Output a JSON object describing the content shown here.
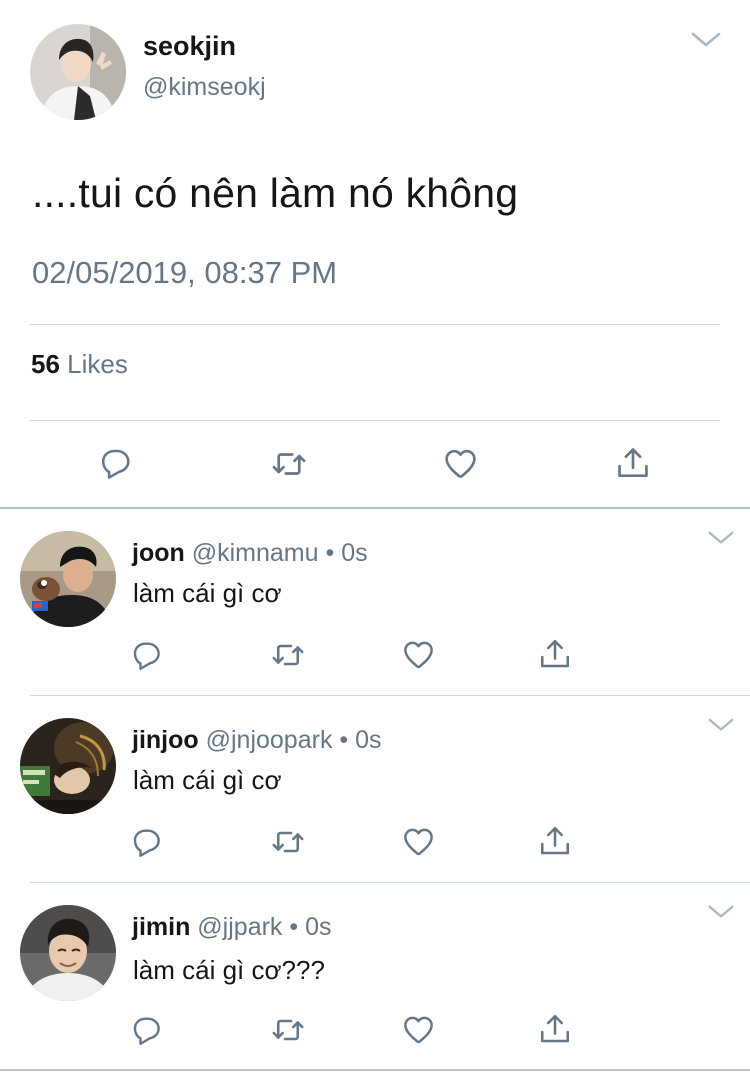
{
  "main_tweet": {
    "name": "seokjin",
    "handle": "@kimseokj",
    "text": "....tui có nên làm nó không",
    "timestamp": "02/05/2019, 08:37 PM",
    "likes_count": "56",
    "likes_label": "Likes",
    "icons": [
      "reply-icon",
      "retweet-icon",
      "like-icon",
      "share-icon",
      "chevron-down-icon"
    ]
  },
  "replies": [
    {
      "name": "joon",
      "handle": "@kimnamu",
      "dot": "•",
      "time": "0s",
      "text": "làm cái gì cơ"
    },
    {
      "name": "jinjoo",
      "handle": "@jnjoopark",
      "dot": "•",
      "time": "0s",
      "text": "làm cái gì cơ"
    },
    {
      "name": "jimin",
      "handle": "@jjpark",
      "dot": "•",
      "time": "0s",
      "text": "làm cái gì cơ???"
    }
  ],
  "colors": {
    "text_primary": "#14171a",
    "text_secondary": "#657786",
    "divider": "#ccd6dd",
    "icon": "#657786"
  }
}
